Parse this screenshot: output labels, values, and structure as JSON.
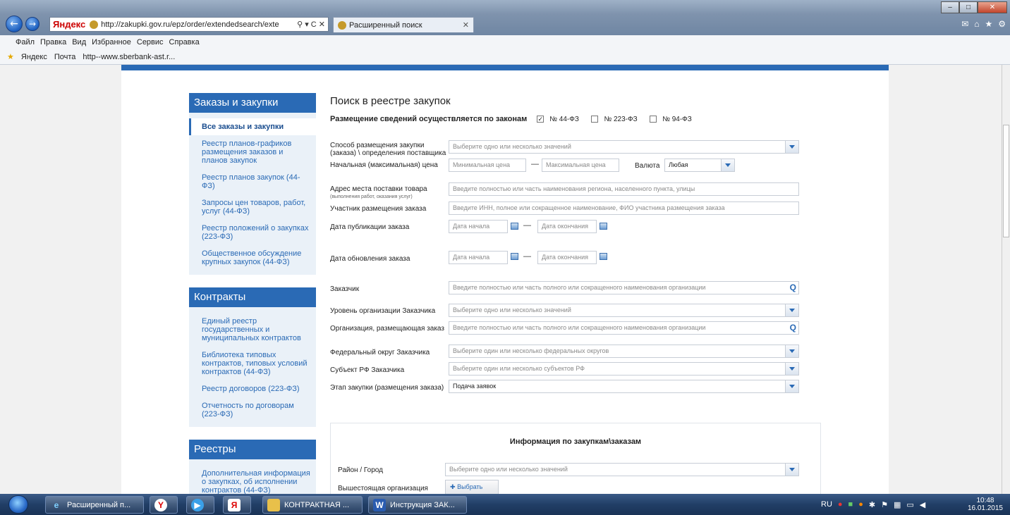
{
  "browser": {
    "address": "http://zakupki.gov.ru/epz/order/extendedsearch/exte",
    "address_brand": "Яндекс",
    "tab_title": "Расширенный поиск",
    "menu": [
      "Файл",
      "Правка",
      "Вид",
      "Избранное",
      "Сервис",
      "Справка"
    ],
    "favorites": [
      "Яндекс",
      "Почта",
      "http--www.sberbank-ast.r..."
    ]
  },
  "sidebar": {
    "sections": [
      {
        "title": "Заказы и закупки",
        "items": [
          "Все заказы и закупки",
          "Реестр планов-графиков размещения заказов и планов закупок",
          "Реестр планов закупок (44-ФЗ)",
          "Запросы цен товаров, работ, услуг (44-ФЗ)",
          "Реестр положений о закупках (223-ФЗ)",
          "Общественное обсуждение крупных закупок (44-ФЗ)"
        ]
      },
      {
        "title": "Контракты",
        "items": [
          "Единый реестр государственных и муниципальных контрактов",
          "Библиотека типовых контрактов, типовых условий контрактов (44-ФЗ)",
          "Реестр договоров (223-ФЗ)",
          "Отчетность по договорам (223-ФЗ)"
        ]
      },
      {
        "title": "Реестры",
        "items": [
          "Дополнительная информация о закупках, об исполнении контрактов (44-ФЗ)"
        ]
      }
    ]
  },
  "search": {
    "title": "Поиск в реестре закупок",
    "laws_label": "Размещение сведений осуществляется по законам",
    "laws": [
      {
        "label": "№ 44-ФЗ",
        "checked": true
      },
      {
        "label": "№ 223-ФЗ",
        "checked": false
      },
      {
        "label": "№ 94-ФЗ",
        "checked": false
      }
    ],
    "method_label": "Способ размещения закупки (заказа) \\ определения поставщика",
    "method_placeholder": "Выберите одно или несколько значений",
    "price_label": "Начальная (максимальная) цена",
    "price_min_placeholder": "Минимальная цена",
    "price_max_placeholder": "Максимальная цена",
    "currency_label": "Валюта",
    "currency_value": "Любая",
    "address_label": "Адрес места поставки товара",
    "address_sublabel": "(выполнения работ, оказания услуг)",
    "address_placeholder": "Введите полностью или часть наименования региона, населенного пункта, улицы",
    "participant_label": "Участник размещения заказа",
    "participant_placeholder": "Введите ИНН, полное или сокращенное наименование, ФИО участника размещения заказа",
    "pubdate_label": "Дата публикации заказа",
    "date_start_placeholder": "Дата начала",
    "date_end_placeholder": "Дата окончания",
    "upddate_label": "Дата обновления заказа",
    "customer_label": "Заказчик",
    "customer_placeholder": "Введите полностью или часть полного или сокращенного наименования организации",
    "level_label": "Уровень организации Заказчика",
    "level_placeholder": "Выберите одно или несколько значений",
    "org_label": "Организация, размещающая заказ",
    "org_placeholder": "Введите полностью или часть полного или сокращенного наименования организации",
    "district_label": "Федеральный округ Заказчика",
    "district_placeholder": "Выберите один или несколько федеральных округов",
    "subject_label": "Субъект РФ Заказчика",
    "subject_placeholder": "Выберите один или несколько субъектов РФ",
    "stage_label": "Этап закупки (размещения заказа)",
    "stage_value": "Подача заявок",
    "info_title": "Информация по закупкам\\заказам",
    "city_label": "Район / Город",
    "city_placeholder": "Выберите одно или несколько значений",
    "parent_org_label": "Вышестоящая организация",
    "choose_button": "Выбрать"
  },
  "taskbar": {
    "items": [
      "Расширенный п...",
      "КОНТРАКТНАЯ ...",
      "Инструкция ЗАК..."
    ],
    "lang": "RU",
    "time": "10:48",
    "date": "16.01.2015"
  }
}
